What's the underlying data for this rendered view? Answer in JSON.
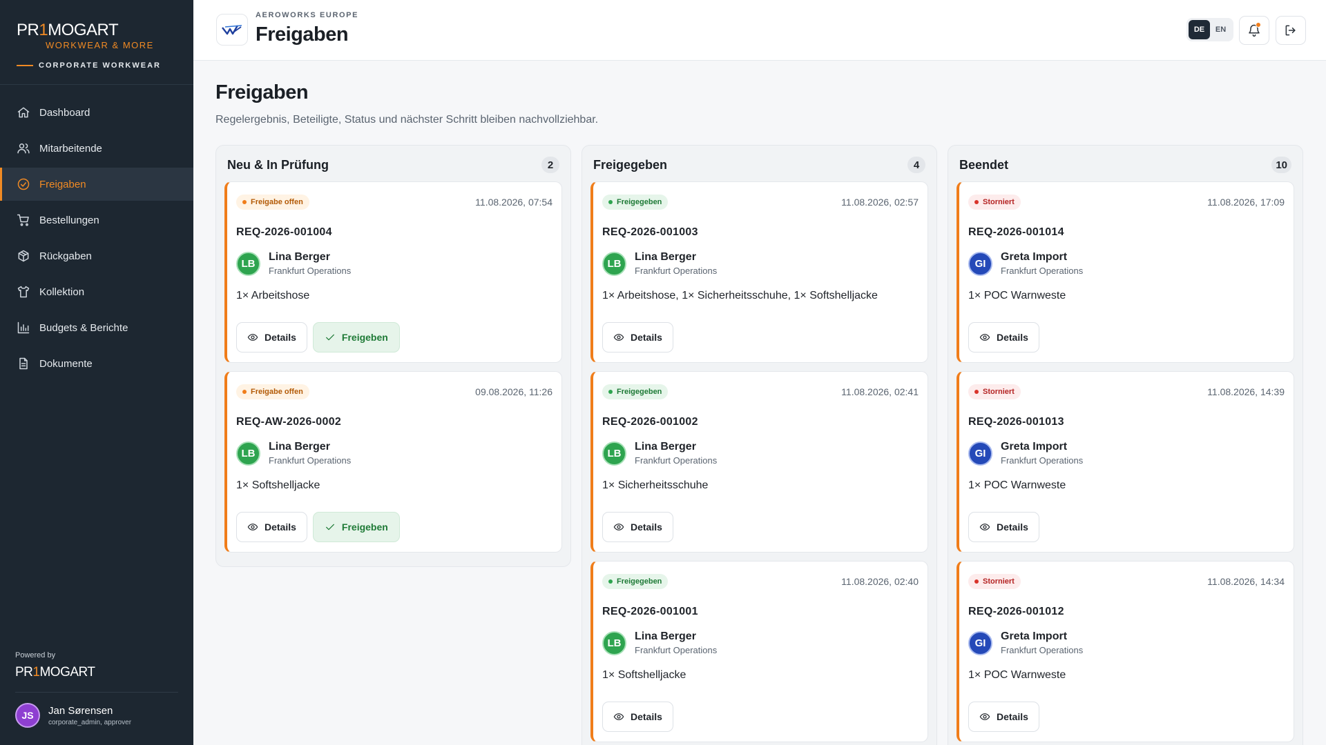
{
  "sidebar": {
    "brand": {
      "prefix": "PR",
      "one": "1",
      "suffix": "MOGART",
      "tagline": "WORKWEAR & MORE",
      "sub": "CORPORATE WORKWEAR"
    },
    "nav": [
      {
        "label": "Dashboard",
        "icon": "home-icon"
      },
      {
        "label": "Mitarbeitende",
        "icon": "users-icon"
      },
      {
        "label": "Freigaben",
        "icon": "check-circle-icon",
        "active": true
      },
      {
        "label": "Bestellungen",
        "icon": "cart-icon"
      },
      {
        "label": "Rückgaben",
        "icon": "package-return-icon"
      },
      {
        "label": "Kollektion",
        "icon": "shirt-icon"
      },
      {
        "label": "Budgets & Berichte",
        "icon": "bar-chart-icon"
      },
      {
        "label": "Dokumente",
        "icon": "document-icon"
      }
    ],
    "powered_by": "Powered by",
    "powered_logo": {
      "prefix": "PR",
      "one": "1",
      "suffix": "MOGART"
    },
    "user": {
      "initials": "JS",
      "name": "Jan Sørensen",
      "role": "corporate_admin, approver"
    }
  },
  "header": {
    "company": "AEROWORKS EUROPE",
    "title": "Freigaben",
    "lang": {
      "de": "DE",
      "en": "EN",
      "active": "DE"
    }
  },
  "main": {
    "title": "Freigaben",
    "subtitle": "Regelergebnis, Beteiligte, Status und nächster Schritt bleiben nachvollziehbar.",
    "columns": [
      {
        "title": "Neu & In Prüfung",
        "count": "2",
        "cards": [
          {
            "status": "Freigabe offen",
            "status_type": "pending",
            "date": "11.08.2026, 07:54",
            "id": "REQ-2026-001004",
            "initials": "LB",
            "avatar_color": "green",
            "name": "Lina Berger",
            "dept": "Frankfurt Operations",
            "items": "1× Arbeitshose",
            "details_label": "Details",
            "approve_label": "Freigeben"
          },
          {
            "status": "Freigabe offen",
            "status_type": "pending",
            "date": "09.08.2026, 11:26",
            "id": "REQ-AW-2026-0002",
            "initials": "LB",
            "avatar_color": "green",
            "name": "Lina Berger",
            "dept": "Frankfurt Operations",
            "items": "1× Softshelljacke",
            "details_label": "Details",
            "approve_label": "Freigeben"
          }
        ]
      },
      {
        "title": "Freigegeben",
        "count": "4",
        "cards": [
          {
            "status": "Freigegeben",
            "status_type": "approved",
            "date": "11.08.2026, 02:57",
            "id": "REQ-2026-001003",
            "initials": "LB",
            "avatar_color": "green",
            "name": "Lina Berger",
            "dept": "Frankfurt Operations",
            "items": "1× Arbeitshose, 1× Sicherheitsschuhe, 1× Softshelljacke",
            "details_label": "Details"
          },
          {
            "status": "Freigegeben",
            "status_type": "approved",
            "date": "11.08.2026, 02:41",
            "id": "REQ-2026-001002",
            "initials": "LB",
            "avatar_color": "green",
            "name": "Lina Berger",
            "dept": "Frankfurt Operations",
            "items": "1× Sicherheitsschuhe",
            "details_label": "Details"
          },
          {
            "status": "Freigegeben",
            "status_type": "approved",
            "date": "11.08.2026, 02:40",
            "id": "REQ-2026-001001",
            "initials": "LB",
            "avatar_color": "green",
            "name": "Lina Berger",
            "dept": "Frankfurt Operations",
            "items": "1× Softshelljacke",
            "details_label": "Details"
          }
        ]
      },
      {
        "title": "Beendet",
        "count": "10",
        "cards": [
          {
            "status": "Storniert",
            "status_type": "cancelled",
            "date": "11.08.2026, 17:09",
            "id": "REQ-2026-001014",
            "initials": "GI",
            "avatar_color": "blue",
            "name": "Greta Import",
            "dept": "Frankfurt Operations",
            "items": "1× POC Warnweste",
            "details_label": "Details"
          },
          {
            "status": "Storniert",
            "status_type": "cancelled",
            "date": "11.08.2026, 14:39",
            "id": "REQ-2026-001013",
            "initials": "GI",
            "avatar_color": "blue",
            "name": "Greta Import",
            "dept": "Frankfurt Operations",
            "items": "1× POC Warnweste",
            "details_label": "Details"
          },
          {
            "status": "Storniert",
            "status_type": "cancelled",
            "date": "11.08.2026, 14:34",
            "id": "REQ-2026-001012",
            "initials": "GI",
            "avatar_color": "blue",
            "name": "Greta Import",
            "dept": "Frankfurt Operations",
            "items": "1× POC Warnweste",
            "details_label": "Details"
          }
        ]
      }
    ]
  },
  "colors": {
    "accent": "#f07d1a",
    "sidebar_bg": "#1d2731",
    "approved": "#2ea44f",
    "cancelled": "#d9342b"
  }
}
